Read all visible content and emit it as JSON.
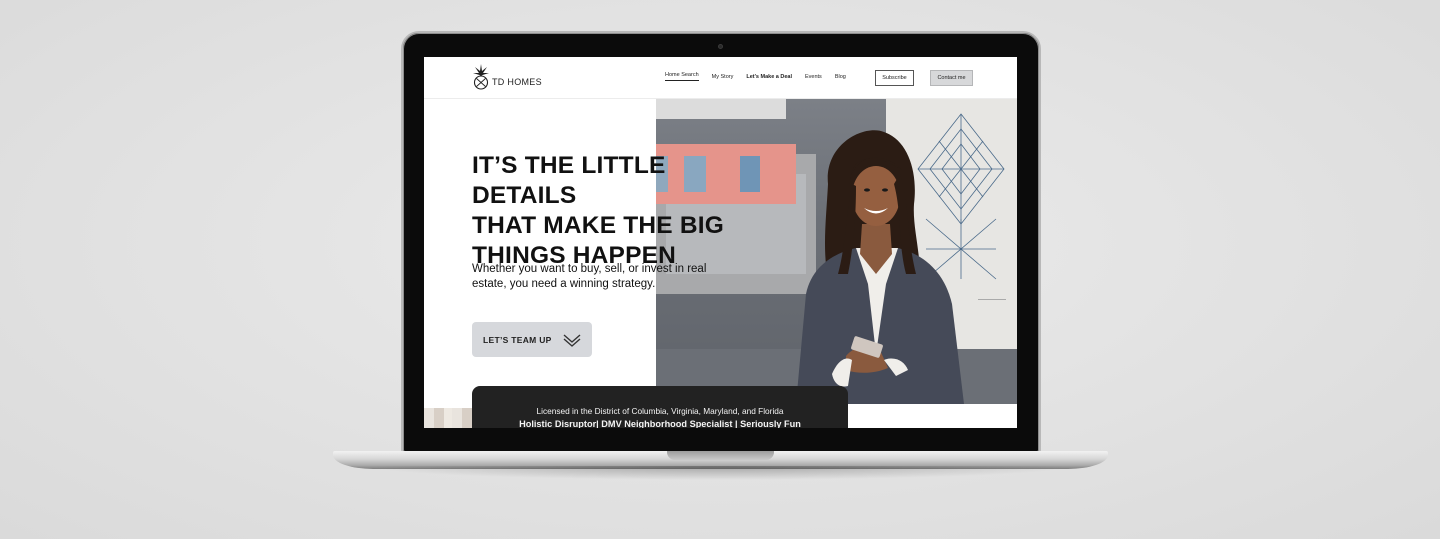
{
  "site": {
    "brand": "TD HOMES",
    "nav": {
      "links": [
        {
          "label": "Home Search"
        },
        {
          "label": "My Story"
        },
        {
          "label": "Let's Make a Deal"
        },
        {
          "label": "Events"
        },
        {
          "label": "Blog"
        }
      ],
      "subscribe_label": "Subscribe",
      "contact_label": "Contact me"
    },
    "hero": {
      "headline_line1": "IT’S THE LITTLE DETAILS",
      "headline_line2_light": "THAT MAKE ",
      "headline_line2_bold": "THE BIG",
      "headline_line3": "THINGS HAPPEN",
      "subtext": "Whether you want to buy, sell, or invest in real estate, you need a winning strategy.",
      "cta_label": "LET’S TEAM UP"
    },
    "banner": {
      "line1": "Licensed in the District of Columbia, Virginia, Maryland, and Florida",
      "line2": "Holistic Disruptor| DMV Neighborhood Specialist | Seriously Fun"
    }
  },
  "colors": {
    "background": "#e3e3e3",
    "bezel": "#0b0b0b",
    "cta_bg": "#d6d8dc",
    "banner_bg": "#222222",
    "accent_pink": "#e5948b"
  },
  "icons": [
    "pineapple-logo-icon",
    "double-chevron-down-icon",
    "camera-icon"
  ]
}
